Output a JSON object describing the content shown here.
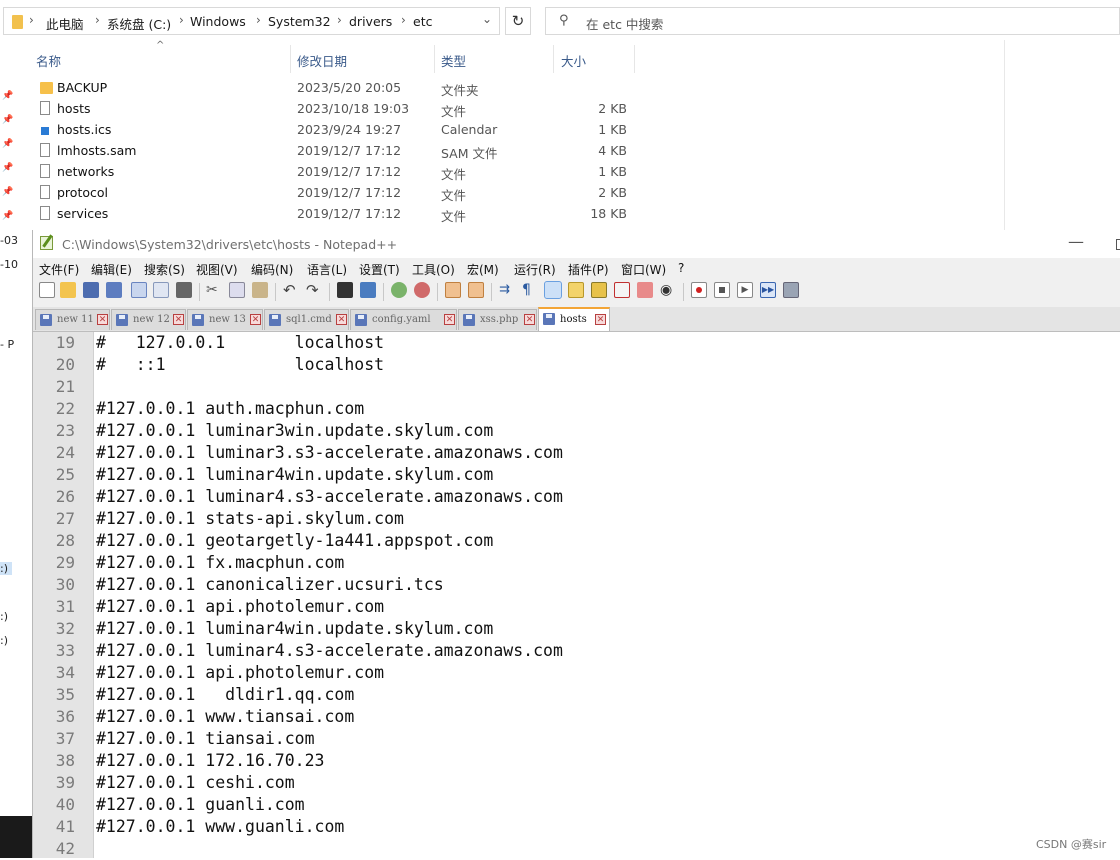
{
  "explorer": {
    "breadcrumb": [
      "此电脑",
      "系统盘 (C:)",
      "Windows",
      "System32",
      "drivers",
      "etc"
    ],
    "search_placeholder": "在 etc 中搜索",
    "columns": {
      "name": "名称",
      "date": "修改日期",
      "type": "类型",
      "size": "大小"
    },
    "files": [
      {
        "name": "BACKUP",
        "date": "2023/5/20 20:05",
        "type": "文件夹",
        "size": "",
        "icon": "folder-icon"
      },
      {
        "name": "hosts",
        "date": "2023/10/18 19:03",
        "type": "文件",
        "size": "2 KB",
        "icon": "file-icon"
      },
      {
        "name": "hosts.ics",
        "date": "2023/9/24 19:27",
        "type": "Calendar",
        "size": "1 KB",
        "icon": "calendar-file-icon"
      },
      {
        "name": "lmhosts.sam",
        "date": "2019/12/7 17:12",
        "type": "SAM 文件",
        "size": "4 KB",
        "icon": "file-icon"
      },
      {
        "name": "networks",
        "date": "2019/12/7 17:12",
        "type": "文件",
        "size": "1 KB",
        "icon": "file-icon"
      },
      {
        "name": "protocol",
        "date": "2019/12/7 17:12",
        "type": "文件",
        "size": "2 KB",
        "icon": "file-icon"
      },
      {
        "name": "services",
        "date": "2019/12/7 17:12",
        "type": "文件",
        "size": "18 KB",
        "icon": "file-icon"
      }
    ],
    "side_fragments": [
      "-03",
      "-10",
      "- P",
      ":)",
      ":)",
      ":)"
    ]
  },
  "notepad": {
    "title": "C:\\Windows\\System32\\drivers\\etc\\hosts - Notepad++",
    "menu": [
      "文件(F)",
      "编辑(E)",
      "搜索(S)",
      "视图(V)",
      "编码(N)",
      "语言(L)",
      "设置(T)",
      "工具(O)",
      "宏(M)",
      "运行(R)",
      "插件(P)",
      "窗口(W)",
      "?"
    ],
    "tabs": [
      {
        "label": "new 11",
        "active": false
      },
      {
        "label": "new 12",
        "active": false
      },
      {
        "label": "new 13",
        "active": false
      },
      {
        "label": "sql1.cmd",
        "active": false
      },
      {
        "label": "config.yaml",
        "active": false
      },
      {
        "label": "xss.php",
        "active": false
      },
      {
        "label": "hosts",
        "active": true
      }
    ],
    "lines": [
      {
        "n": "19",
        "text": "#   127.0.0.1       localhost"
      },
      {
        "n": "20",
        "text": "#   ::1             localhost"
      },
      {
        "n": "21",
        "text": ""
      },
      {
        "n": "22",
        "text": "#127.0.0.1 auth.macphun.com"
      },
      {
        "n": "23",
        "text": "#127.0.0.1 luminar3win.update.skylum.com"
      },
      {
        "n": "24",
        "text": "#127.0.0.1 luminar3.s3-accelerate.amazonaws.com"
      },
      {
        "n": "25",
        "text": "#127.0.0.1 luminar4win.update.skylum.com"
      },
      {
        "n": "26",
        "text": "#127.0.0.1 luminar4.s3-accelerate.amazonaws.com"
      },
      {
        "n": "27",
        "text": "#127.0.0.1 stats-api.skylum.com"
      },
      {
        "n": "28",
        "text": "#127.0.0.1 geotargetly-1a441.appspot.com"
      },
      {
        "n": "29",
        "text": "#127.0.0.1 fx.macphun.com"
      },
      {
        "n": "30",
        "text": "#127.0.0.1 canonicalizer.ucsuri.tcs"
      },
      {
        "n": "31",
        "text": "#127.0.0.1 api.photolemur.com"
      },
      {
        "n": "32",
        "text": "#127.0.0.1 luminar4win.update.skylum.com"
      },
      {
        "n": "33",
        "text": "#127.0.0.1 luminar4.s3-accelerate.amazonaws.com"
      },
      {
        "n": "34",
        "text": "#127.0.0.1 api.photolemur.com"
      },
      {
        "n": "35",
        "text": "#127.0.0.1   dldir1.qq.com"
      },
      {
        "n": "36",
        "text": "#127.0.0.1 www.tiansai.com"
      },
      {
        "n": "37",
        "text": "#127.0.0.1 tiansai.com"
      },
      {
        "n": "38",
        "text": "#127.0.0.1 172.16.70.23"
      },
      {
        "n": "39",
        "text": "#127.0.0.1 ceshi.com"
      },
      {
        "n": "40",
        "text": "#127.0.0.1 guanli.com"
      },
      {
        "n": "41",
        "text": "#127.0.0.1 www.guanli.com"
      },
      {
        "n": "42",
        "text": ""
      }
    ]
  },
  "watermark": "CSDN @赛sir"
}
